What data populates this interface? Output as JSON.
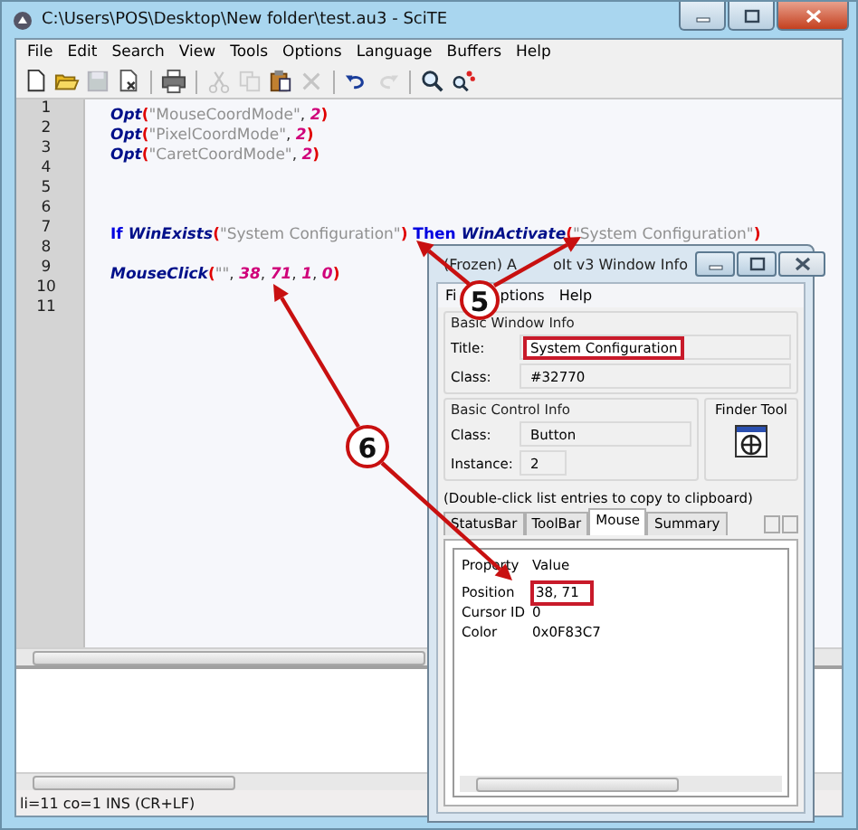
{
  "window": {
    "title": "C:\\Users\\POS\\Desktop\\New folder\\test.au3 - SciTE"
  },
  "menu": [
    "File",
    "Edit",
    "Search",
    "View",
    "Tools",
    "Options",
    "Language",
    "Buffers",
    "Help"
  ],
  "toolbar": [
    {
      "kind": "new",
      "disabled": false
    },
    {
      "kind": "open",
      "disabled": false
    },
    {
      "kind": "save",
      "disabled": true
    },
    {
      "kind": "close",
      "disabled": false
    },
    {
      "kind": "separator"
    },
    {
      "kind": "print",
      "disabled": false
    },
    {
      "kind": "separator"
    },
    {
      "kind": "cut",
      "disabled": true
    },
    {
      "kind": "copy",
      "disabled": true
    },
    {
      "kind": "paste",
      "disabled": false
    },
    {
      "kind": "delete",
      "disabled": true
    },
    {
      "kind": "separator"
    },
    {
      "kind": "undo",
      "disabled": false
    },
    {
      "kind": "redo",
      "disabled": true
    },
    {
      "kind": "separator"
    },
    {
      "kind": "find",
      "disabled": false
    },
    {
      "kind": "replace",
      "disabled": false
    }
  ],
  "editor": {
    "lines": [
      {
        "number": "1",
        "tokens": [
          {
            "kind": "function",
            "text": "Opt"
          },
          {
            "kind": "paren",
            "text": "("
          },
          {
            "kind": "string",
            "text": "\"MouseCoordMode\""
          },
          {
            "kind": "plain",
            "text": ", "
          },
          {
            "kind": "number",
            "text": "2"
          },
          {
            "kind": "paren",
            "text": ")"
          }
        ]
      },
      {
        "number": "2",
        "tokens": [
          {
            "kind": "function",
            "text": "Opt"
          },
          {
            "kind": "paren",
            "text": "("
          },
          {
            "kind": "string",
            "text": "\"PixelCoordMode\""
          },
          {
            "kind": "plain",
            "text": ", "
          },
          {
            "kind": "number",
            "text": "2"
          },
          {
            "kind": "paren",
            "text": ")"
          }
        ]
      },
      {
        "number": "3",
        "tokens": [
          {
            "kind": "function",
            "text": "Opt"
          },
          {
            "kind": "paren",
            "text": "("
          },
          {
            "kind": "string",
            "text": "\"CaretCoordMode\""
          },
          {
            "kind": "plain",
            "text": ", "
          },
          {
            "kind": "number",
            "text": "2"
          },
          {
            "kind": "paren",
            "text": ")"
          }
        ]
      },
      {
        "number": "4"
      },
      {
        "number": "5"
      },
      {
        "number": "6"
      },
      {
        "number": "7",
        "tokens": [
          {
            "kind": "keyword",
            "text": "If "
          },
          {
            "kind": "function",
            "text": "WinExists"
          },
          {
            "kind": "paren",
            "text": "("
          },
          {
            "kind": "string",
            "text": "\"System Configuration\""
          },
          {
            "kind": "paren",
            "text": ")"
          },
          {
            "kind": "keyword",
            "text": " Then "
          },
          {
            "kind": "function",
            "text": "WinActivate"
          },
          {
            "kind": "paren",
            "text": "("
          },
          {
            "kind": "string",
            "text": "\"System Configuration\""
          },
          {
            "kind": "paren",
            "text": ")"
          }
        ]
      },
      {
        "number": "8"
      },
      {
        "number": "9",
        "tokens": [
          {
            "kind": "function",
            "text": "MouseClick"
          },
          {
            "kind": "paren",
            "text": "("
          },
          {
            "kind": "string",
            "text": "\"\""
          },
          {
            "kind": "plain",
            "text": ", "
          },
          {
            "kind": "number",
            "text": "38"
          },
          {
            "kind": "plain",
            "text": ", "
          },
          {
            "kind": "number",
            "text": "71"
          },
          {
            "kind": "plain",
            "text": ", "
          },
          {
            "kind": "number",
            "text": "1"
          },
          {
            "kind": "plain",
            "text": ", "
          },
          {
            "kind": "number",
            "text": "0"
          },
          {
            "kind": "paren",
            "text": ")"
          }
        ]
      },
      {
        "number": "10"
      },
      {
        "number": "11"
      }
    ]
  },
  "status_bar": "li=11 co=1 INS (CR+LF)",
  "info_window": {
    "title_parts": [
      "(Frozen) A",
      "oIt v3 Window Info"
    ],
    "menu": [
      "Fi",
      "ptions",
      "Help"
    ],
    "basic_window": {
      "heading": "Basic Window Info",
      "fields": [
        {
          "label": "Title:",
          "value": "System Configuration",
          "highlighted": true
        },
        {
          "label": "Class:",
          "value": "#32770",
          "highlighted": false
        }
      ]
    },
    "basic_control": {
      "heading": "Basic Control Info",
      "fields": [
        {
          "label": "Class:",
          "value": "Button"
        },
        {
          "label": "Instance:",
          "value": "2"
        }
      ]
    },
    "finder": {
      "label": "Finder Tool"
    },
    "hint": "(Double-click list entries to copy to clipboard)",
    "tabs": [
      {
        "label": "StatusBar",
        "selected": false
      },
      {
        "label": "ToolBar",
        "selected": false
      },
      {
        "label": "Mouse",
        "selected": true
      },
      {
        "label": "Summary",
        "selected": false
      }
    ],
    "list": {
      "columns": [
        "Property",
        "Value"
      ],
      "rows": [
        {
          "property": "Position",
          "value": "38, 71",
          "highlighted": true
        },
        {
          "property": "Cursor ID",
          "value": "0",
          "highlighted": false
        },
        {
          "property": "Color",
          "value": "0x0F83C7",
          "highlighted": false
        }
      ]
    }
  },
  "annotations": [
    {
      "label": "5"
    },
    {
      "label": "6"
    }
  ]
}
